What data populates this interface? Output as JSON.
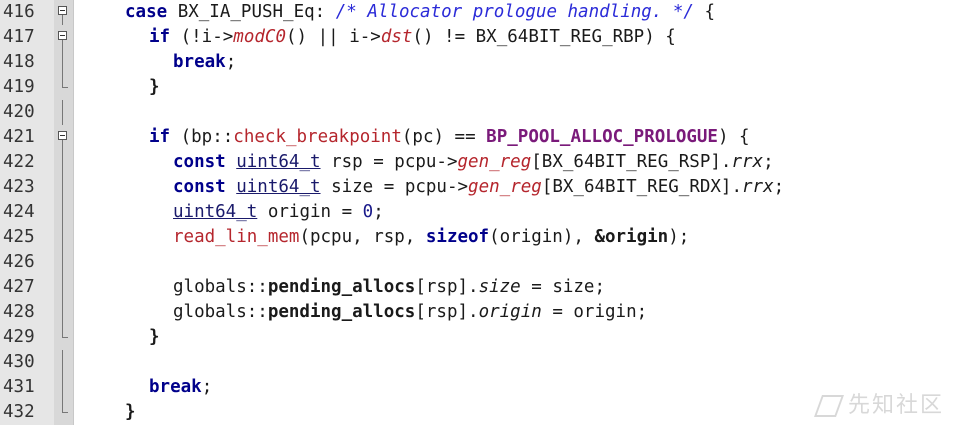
{
  "editor": {
    "watermark": "先知社区",
    "lines": [
      {
        "n": "416",
        "fold": "box"
      },
      {
        "n": "417",
        "fold": "box"
      },
      {
        "n": "418",
        "fold": "line"
      },
      {
        "n": "419",
        "fold": "end"
      },
      {
        "n": "420",
        "fold": "line"
      },
      {
        "n": "421",
        "fold": "box"
      },
      {
        "n": "422",
        "fold": "line"
      },
      {
        "n": "423",
        "fold": "line"
      },
      {
        "n": "424",
        "fold": "line"
      },
      {
        "n": "425",
        "fold": "line"
      },
      {
        "n": "426",
        "fold": "line"
      },
      {
        "n": "427",
        "fold": "line"
      },
      {
        "n": "428",
        "fold": "line"
      },
      {
        "n": "429",
        "fold": "end"
      },
      {
        "n": "430",
        "fold": "line"
      },
      {
        "n": "431",
        "fold": "line"
      },
      {
        "n": "432",
        "fold": "end"
      }
    ],
    "code": {
      "l416": {
        "t1": "case",
        "t2": " BX_IA_PUSH_Eq: ",
        "t3": "/* Allocator prologue handling. */",
        "t4": " {"
      },
      "l417": {
        "t1": "if",
        "t2": " (!i->",
        "t3": "modC0",
        "t4": "() || i->",
        "t5": "dst",
        "t6": "() != BX_64BIT_REG_RBP) {"
      },
      "l418": {
        "t1": "break",
        "t2": ";"
      },
      "l419": {
        "t1": "}"
      },
      "l421": {
        "t1": "if",
        "t2": " (bp::",
        "t3": "check_breakpoint",
        "t4": "(pc) == ",
        "t5": "BP_POOL_ALLOC_PROLOGUE",
        "t6": ") {"
      },
      "l422": {
        "t1": "const",
        "t2": " ",
        "t3": "uint64_t",
        "t4": " rsp = pcpu->",
        "t5": "gen_reg",
        "t6": "[BX_64BIT_REG_RSP].",
        "t7": "rrx",
        "t8": ";"
      },
      "l423": {
        "t1": "const",
        "t2": " ",
        "t3": "uint64_t",
        "t4": " size = pcpu->",
        "t5": "gen_reg",
        "t6": "[BX_64BIT_REG_RDX].",
        "t7": "rrx",
        "t8": ";"
      },
      "l424": {
        "t1": "uint64_t",
        "t2": " origin = ",
        "t3": "0",
        "t4": ";"
      },
      "l425": {
        "t1": "read_lin_mem",
        "t2": "(pcpu, rsp, ",
        "t3": "sizeof",
        "t4": "(origin), ",
        "t5": "&origin",
        "t6": ");"
      },
      "l427": {
        "t1": "globals::",
        "t2": "pending_allocs",
        "t3": "[rsp].",
        "t4": "size",
        "t5": " = size;"
      },
      "l428": {
        "t1": "globals::",
        "t2": "pending_allocs",
        "t3": "[rsp].",
        "t4": "origin",
        "t5": " = origin;"
      },
      "l429": {
        "t1": "}"
      },
      "l431": {
        "t1": "break",
        "t2": ";"
      },
      "l432": {
        "t1": "}"
      }
    }
  }
}
